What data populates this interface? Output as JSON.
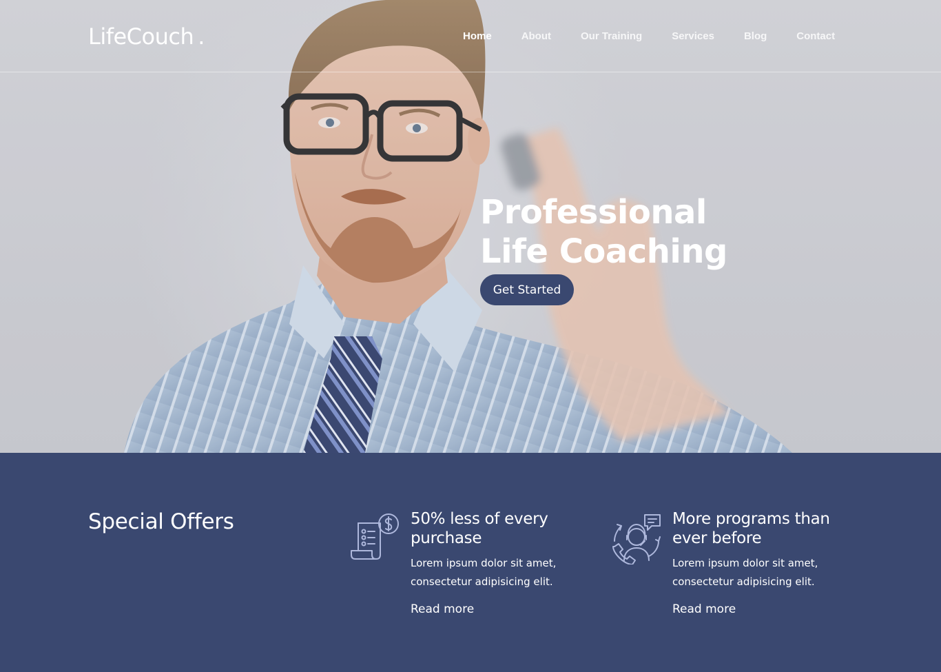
{
  "header": {
    "logo": "LifeCouch",
    "logo_dot": ".",
    "nav": [
      {
        "label": "Home",
        "active": true
      },
      {
        "label": "About",
        "active": false
      },
      {
        "label": "Our Training",
        "active": false
      },
      {
        "label": "Services",
        "active": false
      },
      {
        "label": "Blog",
        "active": false
      },
      {
        "label": "Contact",
        "active": false
      }
    ]
  },
  "hero": {
    "title": "Professional Life Coaching",
    "cta_label": "Get Started",
    "image": "man-with-glasses-writing-photo"
  },
  "offers": {
    "title": "Special Offers",
    "items": [
      {
        "icon": "invoice-dollar-icon",
        "heading": "50% less of every purchase",
        "text": "Lorem ipsum dolor sit amet, consectetur adipisicing elit.",
        "link": "Read more"
      },
      {
        "icon": "support-agent-icon",
        "heading": "More programs than ever before",
        "text": "Lorem ipsum dolor sit amet, consectetur adipisicing elit.",
        "link": "Read more"
      }
    ]
  },
  "colors": {
    "brand": "#3a4870",
    "text_light": "#ffffff",
    "icon_stroke": "#aeb8dc"
  }
}
